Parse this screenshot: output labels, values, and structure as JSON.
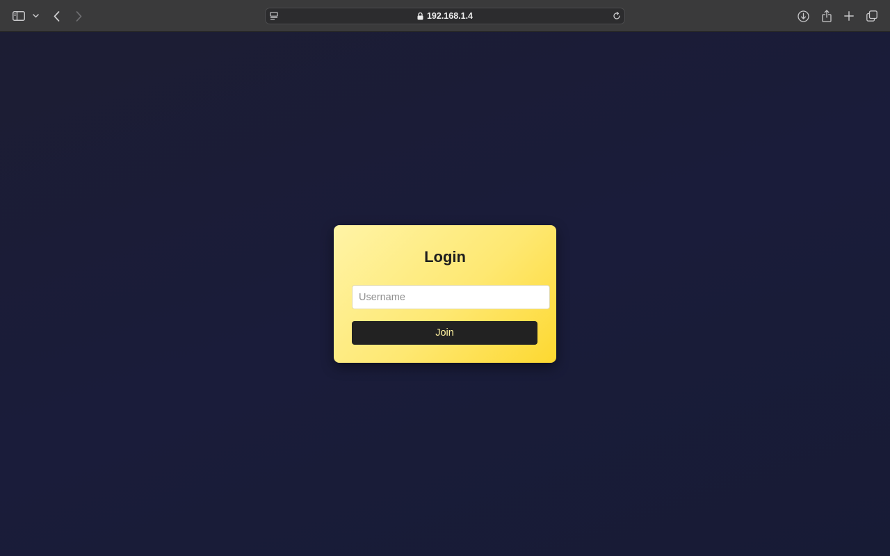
{
  "browser": {
    "url": "192.168.1.4",
    "toolbar": {
      "sidebar_icon": "sidebar-icon",
      "sidebar_menu_icon": "chevron-down-icon",
      "back_icon": "chevron-left-icon",
      "forward_icon": "chevron-right-icon",
      "page_menu_icon": "page-menu-icon",
      "lock_icon": "lock-icon",
      "reload_icon": "reload-icon",
      "downloads_icon": "download-icon",
      "share_icon": "share-icon",
      "new_tab_icon": "plus-icon",
      "tabs_overview_icon": "tabs-overview-icon"
    }
  },
  "login": {
    "title": "Login",
    "username_placeholder": "Username",
    "username_value": "",
    "join_label": "Join"
  },
  "colors": {
    "page_background": "#1b1d35",
    "card_gradient_start": "#fff4a6",
    "card_gradient_end": "#fdd830",
    "button_background": "#222222",
    "button_text": "#fff2a0"
  }
}
